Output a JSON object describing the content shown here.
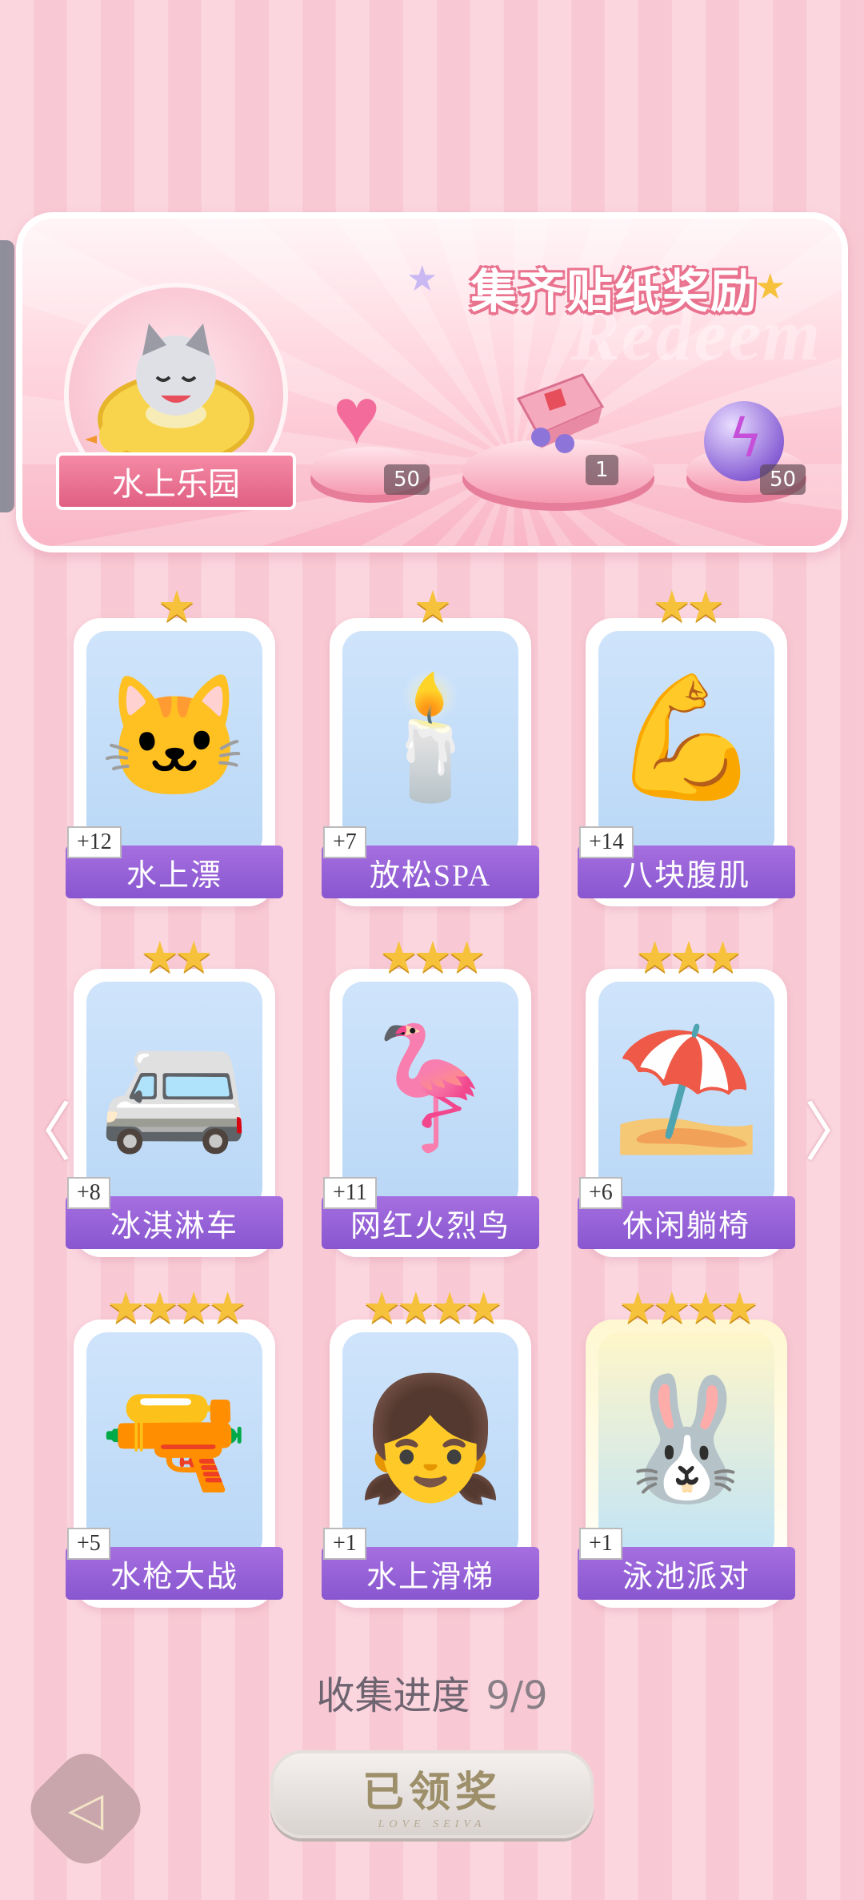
{
  "banner": {
    "title": "集齐贴纸奖励",
    "watermark": "Redeem",
    "theme_label": "水上乐园",
    "rewards": [
      {
        "icon": "pink-heart-gem-icon",
        "count": "50"
      },
      {
        "icon": "gift-box-icon",
        "count": "1"
      },
      {
        "icon": "lightning-orb-icon",
        "count": "50"
      }
    ]
  },
  "cards": [
    {
      "name": "水上漂",
      "plus": "+12",
      "stars": "★",
      "icon": "🐱"
    },
    {
      "name": "放松SPA",
      "plus": "+7",
      "stars": "★",
      "icon": "🕯️"
    },
    {
      "name": "八块腹肌",
      "plus": "+14",
      "stars": "★★",
      "icon": "💪"
    },
    {
      "name": "冰淇淋车",
      "plus": "+8",
      "stars": "★★",
      "icon": "🚐"
    },
    {
      "name": "网红火烈鸟",
      "plus": "+11",
      "stars": "★★★",
      "icon": "🦩"
    },
    {
      "name": "休闲躺椅",
      "plus": "+6",
      "stars": "★★★",
      "icon": "⛱️"
    },
    {
      "name": "水枪大战",
      "plus": "+5",
      "stars": "★★★★",
      "icon": "🔫"
    },
    {
      "name": "水上滑梯",
      "plus": "+1",
      "stars": "★★★★",
      "icon": "👧"
    },
    {
      "name": "泳池派对",
      "plus": "+1",
      "stars": "★★★★",
      "icon": "🐰"
    }
  ],
  "progress": {
    "label": "收集进度",
    "value": "9/9"
  },
  "claim_button": {
    "label": "已领奖",
    "sub": "LOVE SEIVA"
  },
  "nav": {
    "prev": "〈",
    "next": "〉"
  }
}
